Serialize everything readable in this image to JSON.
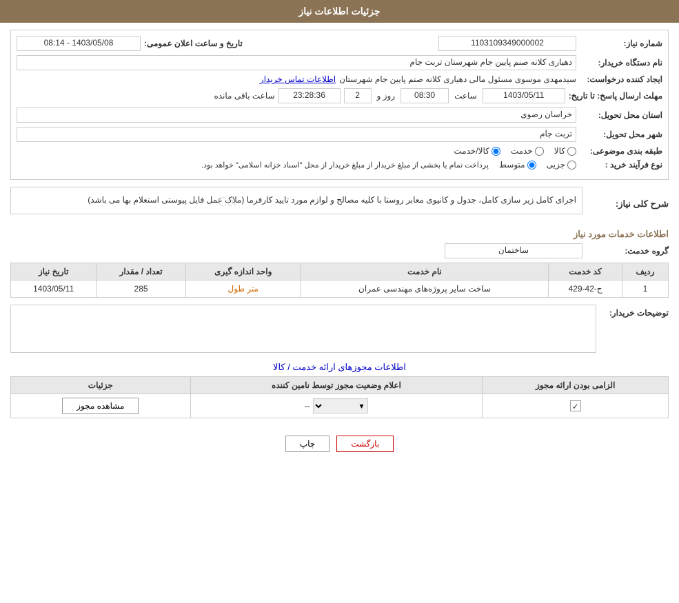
{
  "header": {
    "title": "جزئیات اطلاعات نیاز"
  },
  "form": {
    "need_number_label": "شماره نیاز:",
    "need_number_value": "1103109349000002",
    "buyer_org_label": "نام دستگاه خریدار:",
    "buyer_org_value": "دهیاری کلانه صنم پایین جام شهرستان تربت جام",
    "creator_label": "ایجاد کننده درخواست:",
    "creator_name": "سیدمهدی موسوی مسئول مالی دهیاری کلانه صنم پایین جام شهرستان",
    "creator_link": "اطلاعات تماس خریدار",
    "date_label": "تاریخ و ساعت اعلان عمومی:",
    "date_value": "1403/05/08 - 08:14",
    "reply_deadline_label": "مهلت ارسال پاسخ: تا تاریخ:",
    "reply_date": "1403/05/11",
    "reply_time": "08:30",
    "reply_days": "2",
    "reply_remaining": "23:28:36",
    "province_label": "استان محل تحویل:",
    "province_value": "خراسان رضوی",
    "city_label": "شهر محل تحویل:",
    "city_value": "تربت جام",
    "category_label": "طبقه بندی موضوعی:",
    "category_kala": "کالا",
    "category_khedmat": "خدمت",
    "category_kala_khedmat": "کالا/خدمت",
    "purchase_type_label": "نوع فرآیند خرید :",
    "purchase_jozvi": "جزیی",
    "purchase_motavasset": "متوسط",
    "purchase_note": "پرداخت تمام یا بخشی از مبلغ خریدار از مبلغ خریدار از محل \"اسناد خزانه اسلامی\" خواهد بود.",
    "general_desc_label": "شرح کلی نیاز:",
    "general_desc_value": "اجرای کامل زیر سازی کامل، جدول و کانیوی معابر روستا با کلیه مصالح و لوازم مورد تایید کارفرما (ملاک عمل فایل پیوستی استعلام بها می باشد)",
    "services_title": "اطلاعات خدمات مورد نیاز",
    "service_group_label": "گروه خدمت:",
    "service_group_value": "ساختمان",
    "table": {
      "headers": [
        "ردیف",
        "کد خدمت",
        "نام خدمت",
        "واحد اندازه گیری",
        "تعداد / مقدار",
        "تاریخ نیاز"
      ],
      "rows": [
        {
          "row": "1",
          "code": "ج-42-429",
          "name": "ساخت سایر پروژه‌های مهندسی عمران",
          "unit": "متر طول",
          "quantity": "285",
          "date": "1403/05/11"
        }
      ]
    },
    "buyer_notes_label": "توضیحات خریدار:",
    "buyer_notes_value": "",
    "license_title": "اطلاعات مجوزهای ارائه خدمت / کالا",
    "license_table": {
      "headers": [
        "الزامی بودن ارائه مجوز",
        "اعلام وضعیت مجوز توسط نامین کننده",
        "جزئیات"
      ],
      "rows": [
        {
          "required": "✓",
          "status": "--",
          "details_btn": "مشاهده مجوز"
        }
      ]
    }
  },
  "buttons": {
    "print": "چاپ",
    "back": "بازگشت"
  },
  "icons": {
    "dropdown": "▾"
  }
}
